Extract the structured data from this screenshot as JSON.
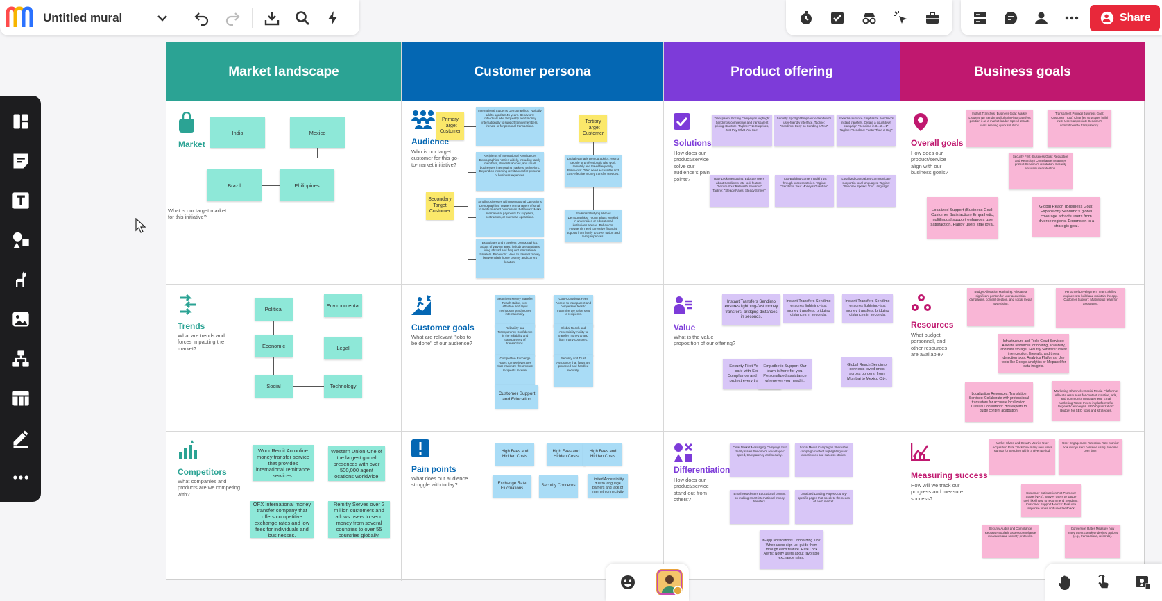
{
  "app": {
    "title": "Untitled mural",
    "share_label": "Share"
  },
  "columns": [
    {
      "title": "Market landscape",
      "color": "#2ba394"
    },
    {
      "title": "Customer persona",
      "color": "#0467b3"
    },
    {
      "title": "Product offering",
      "color": "#7d3bd9"
    },
    {
      "title": "Business goals",
      "color": "#c0186f"
    }
  ],
  "market": {
    "market": {
      "name": "Market",
      "q": "What is our target market for this initiative?",
      "notes": [
        "India",
        "Mexico",
        "Brazil",
        "Philippines"
      ]
    },
    "trends": {
      "name": "Trends",
      "q": "What are trends and forces impacting the market?",
      "notes": [
        "Political",
        "Economic",
        "Social",
        "Environmental",
        "Legal",
        "Technology"
      ]
    },
    "competitors": {
      "name": "Competitors",
      "q": "What companies and products are we competing with?",
      "notes": [
        "WorldRemit\nAn online money transfer service that provides international remittance services.",
        "Western Union\nOne of the largest global presences with over 500,000 agent locations worldwide.",
        "OFX\nInternational money transfer company that offers competitive exchange rates and low fees for individuals and businesses.",
        "Remitly\nServes over 2 million customers and allows users to send money from several countries to over 55 countries globally."
      ]
    }
  },
  "persona": {
    "audience": {
      "name": "Audience",
      "q": "Who is our target customer for this go-to-market initiative?",
      "labels": [
        "Primary Target Customer",
        "Secondary Target Customer",
        "Tertiary Target Customer"
      ],
      "notes": [
        "International Students\nDemographics: Typically adults aged 18-45 years.\nBehaviors: Individuals who frequently send money internationally to support family members, friends, or for personal transactions.",
        "Recipients of International Remittances\nDemographics: Varies widely, including family members, students abroad, and small businesses in emerging markets.\nBehaviors: Depend on incoming remittances for personal or business expenses.",
        "Small Businesses with International Operations\nDemographics: Owners or managers of small to medium-sized businesses.\nBehaviors: Make international payments for suppliers, contractors, or overseas operations.",
        "Expatriates and Travelers\nDemographics: Adults of varying ages, including expatriates living abroad and frequent international travelers.\nBehaviors: Need to transfer money between their home country and current location.",
        "Digital Nomads\nDemographics: Young people or professionals who work remotely and travel frequently.\nBehaviors: Often need accessible and cost-effective money transfer services.",
        "Students Studying Abroad\nDemographics: Young adults enrolled in universities or educational institutions abroad.\nBehaviors: Frequently need to receive financial support from family to cover tuition and living expenses."
      ]
    },
    "goals": {
      "name": "Customer goals",
      "q": "What are relevant \"jobs to be done\" of our audience?",
      "notes": [
        "Seamless Money Transfer\nReach stable, cost-effective and rapid methods to send money internationally.",
        "Cost-Conscious Fees\nAccess to transparent and competitive fees to maximize the value sent to recipients.",
        "Reliability and Transparency\nConfidence in the reliability and transparency of transactions.",
        "Global Reach and Accessibility\nAbility to transfer money to and from many countries.",
        "Competitive Exchange Rates\nCompetitive rates that maximize the amount recipients receive.",
        "Security and Trust\nAssurance that funds are protected and handled securely.",
        "Customer Support and Education"
      ]
    },
    "pain": {
      "name": "Pain points",
      "q": "What does our audience struggle with today?",
      "notes": [
        "High Fees and Hidden Costs",
        "High Fees and Hidden Costs",
        "High Fees and Hidden Costs",
        "Exchange Rate Fluctuations",
        "Security Concerns",
        "Limited Accessibility due to language barriers and lack of internet connectivity"
      ]
    }
  },
  "product": {
    "solutions": {
      "name": "Solutions",
      "q": "How does our product/service solve our audience's pain points?",
      "notes": [
        "Transparent Pricing Campaigns\nHighlight Sendimo's competitive and transparent pricing structure.\nTagline: \"No Surprises, Just Pay What You See\"",
        "Security Spotlight\nEmphasize Sendimo's user-friendly interface.\nTagline: \"Sendimo: Easy as Sending a Text\"",
        "Speed Assurance\nEmphasize Sendimo's instant transfers. Create a countdown campaign \"Sendimo in 3... 2... 1\"\nTagline: \"Sendimo: Faster Than a Hug\"",
        "Rate Lock Messaging: Educate users about Sendimo's rate-lock feature. \"Secure Your Rate with Sendimo\"\nTagline: \"Steady Rates, Steady Smiles\"",
        "Trust-Building Content\nBuild trust through success stories.\nTagline: \"Sendimo: Your Money's Guardian\"",
        "Localized Campaigns\nCommunicate support in local languages.\nTagline: \"Sendimo Speaks Your Language\""
      ]
    },
    "value": {
      "name": "Value",
      "q": "What is the value proposition of our offering?",
      "notes": [
        "Instant Transfers\nSendimo ensures lightning-fast money transfers, bridging distances in seconds.",
        "Instant Transfers\nSendimo ensures lightning-fast money transfers, bridging distances in seconds.",
        "Instant Transfers\nSendimo ensures lightning-fast money transfers, bridging distances in seconds.",
        "Security First\nYour data is safe with Sendimo. Compliance and encryption protect every transaction.",
        "Empathetic Support\nOur team is here for you. Personalized assistance whenever you need it.",
        "Global Reach\nSendimo connects loved ones across borders, from Mumbai to Mexico City."
      ]
    },
    "diff": {
      "name": "Differentiation",
      "q": "How does our product/service stand out from others?",
      "notes": [
        "Clear Market Messaging\nCampaign that clearly states Sendimo's advantages: speed, transparency and security.",
        "Social Media Campaigns\nShareable campaign content highlighting user experiences and success stories.",
        "Email Newsletters\nEducational content on making smart international money transfers.",
        "Localized Landing Pages\nCountry-specific pages that speak to the needs of each market.",
        "In-app Notifications\nOnboarding Tips: When users sign up, guide them through each feature.\nRate Lock Alerts: Notify users about favorable exchange rates."
      ]
    }
  },
  "business": {
    "overall": {
      "name": "Overall goals",
      "q": "How does our product/service align with our business goals?",
      "notes": [
        "Instant Transfers (Business Goal: Market Leadership)\nSendimo's lightning-fast transfers position it as a market leader. Speed attracts users seeking quick solutions.",
        "Transparent Pricing (Business Goal: Customer Trust)\nClear fee structures build trust. Users appreciate Sendimo's commitment to transparency.",
        "Security First (Business Goal: Reputation and Retention)\nCompliance measures protect Sendimo's reputation. Security ensures user retention.",
        "Localized Support (Business Goal: Customer Satisfaction)\nEmpathetic, multilingual support enhances user satisfaction. Happy users stay loyal.",
        "Global Reach (Business Goal: Expansion)\nSendimo's global coverage attracts users from diverse regions. Expansion is a strategic goal."
      ]
    },
    "resources": {
      "name": "Resources",
      "q": "What budget, personnel, and other resources are available?",
      "notes": [
        "Budget Allocation\nMarketing: Allocate a significant portion for user acquisition campaigns, content creation, and social media advertising.",
        "Personnel\nDevelopment Team: Skilled engineers to build and maintain the app. Customer Support: Multilingual team for assistance.",
        "Infrastructure and Tools\nCloud Services: Allocate resources for hosting, scalability, and data storage. Security Software: Invest in encryption, firewalls, and threat detection tools. Analytics Platforms: Use tools like Google Analytics or Mixpanel for data insights.",
        "Localization Resources:\nTranslation Services: Collaborate with professional translators for accurate localization.\nCultural Consultants: Hire experts to guide content adaptation.",
        "Marketing Channels:\nSocial Media Platforms: Allocate resources for content creation, ads, and community management.\nEmail Marketing Tools: Invest in platforms for targeted campaigns.\nSEO Optimization: Budget for SEO tools and strategies."
      ]
    },
    "measuring": {
      "name": "Measuring success",
      "q": "How will we track our progress and measure success?",
      "notes": [
        "Market Share and Growth Metrics\nUser Acquisition Rate\nTrack how many new users sign up for Sendimo within a given period.",
        "User Engagement Retention Rate\nMonitor how many users continue using Sendimo over time.",
        "Customer Satisfaction\nNet Promoter Score (NPS): Survey users to gauge their likelihood to recommend Sendimo.\nCustomer Support Metrics: Evaluate response times and user feedback.",
        "Security Audits and Compliance Reports\nRegularly assess compliance measures and security protocols.",
        "Conversion Rates\nMeasure how many users complete desired actions (e.g., transactions, referrals)."
      ]
    }
  },
  "icons": {
    "logo": "mural-logo",
    "cursor": "mouse-pointer-icon"
  }
}
